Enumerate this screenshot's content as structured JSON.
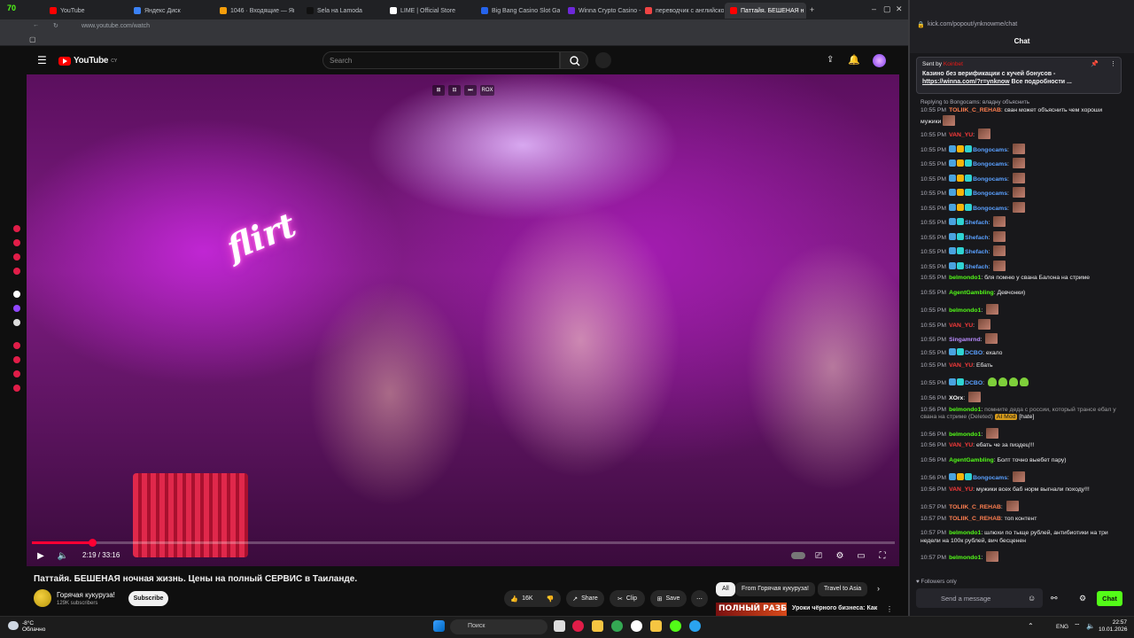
{
  "browser": {
    "tabs": [
      {
        "label": "YouTube",
        "color": "#ff0000"
      },
      {
        "label": "Яндекс Диск",
        "color": "#3b82f6"
      },
      {
        "label": "1046 · Входящие — Янд",
        "color": "#f59e0b"
      },
      {
        "label": "Sela на Lamoda",
        "color": "#111111"
      },
      {
        "label": "LIME | Official Store",
        "color": "#ffffff"
      },
      {
        "label": "Big Bang Casino Slot Gam",
        "color": "#2563eb"
      },
      {
        "label": "Winna Crypto Casino - Be",
        "color": "#6d28d9"
      },
      {
        "label": "переводчик с английско",
        "color": "#ef4444"
      },
      {
        "label": "Паттайя. БЕШЕНАЯ н",
        "color": "#ff0000"
      }
    ],
    "tab_counter": "70",
    "url": "www.youtube.com/watch",
    "chat_url": "kick.com/popout/ynknowme/chat"
  },
  "youtube": {
    "logo": "YouTube",
    "logo_region": "CY",
    "search_placeholder": "Search",
    "video": {
      "sign_text": "flirt",
      "overlay_labels": [
        "⊞",
        "⊟",
        "⏭",
        "ROX"
      ],
      "time_current": "2:19",
      "time_total": "33:16",
      "progress_fraction": 0.07
    },
    "title": "Паттайя. БЕШЕНАЯ ночная жизнь. Цены на полный СЕРВИС в Таиланде.",
    "channel": "Горячая кукуруза!",
    "subscribers": "129K subscribers",
    "subscribe_label": "Subscribe",
    "like_count": "16K",
    "share_label": "Share",
    "clip_label": "Clip",
    "save_label": "Save",
    "chips": [
      "All",
      "From Горячая кукуруза!",
      "Travel to Asia"
    ],
    "rec_thumb_text": "ПОЛНЫЙ РАЗБОР",
    "rec_title": "Уроки чёрного бизнеса: Как"
  },
  "chat": {
    "title": "Chat",
    "pinned": {
      "sent_by_label": "Sent by",
      "sent_by_user": "Koinbet",
      "text_line1": "Казино без верификации с кучей бонусов -",
      "link": "https://winna.com/?r=ynknow",
      "text_line2": "Все подробности ..."
    },
    "reply_context": "Replying to Bongocams: владну объяснить",
    "messages": [
      {
        "time": "10:55 PM",
        "user": "TOLIIK_C_REHAB",
        "color": "#ff7f50",
        "text": "сван может объяснить чем хороши мужики",
        "wrap": true,
        "emote": true,
        "badges": []
      },
      {
        "time": "10:55 PM",
        "user": "VAN_YU",
        "color": "#ff3b3b",
        "text": "",
        "emote": true,
        "badges": []
      },
      {
        "time": "10:55 PM",
        "user": "Bongocams",
        "color": "#5aa0ff",
        "text": "",
        "emote": true,
        "badges": [
          "#4aa3df",
          "#f5b50b",
          "#2fd3d3"
        ]
      },
      {
        "time": "10:55 PM",
        "user": "Bongocams",
        "color": "#5aa0ff",
        "text": "",
        "emote": true,
        "badges": [
          "#4aa3df",
          "#f5b50b",
          "#2fd3d3"
        ]
      },
      {
        "time": "10:55 PM",
        "user": "Bongocams",
        "color": "#5aa0ff",
        "text": "",
        "emote": true,
        "badges": [
          "#4aa3df",
          "#f5b50b",
          "#2fd3d3"
        ]
      },
      {
        "time": "10:55 PM",
        "user": "Bongocams",
        "color": "#5aa0ff",
        "text": "",
        "emote": true,
        "badges": [
          "#4aa3df",
          "#f5b50b",
          "#2fd3d3"
        ]
      },
      {
        "time": "10:55 PM",
        "user": "Bongocams",
        "color": "#5aa0ff",
        "text": "",
        "emote": true,
        "badges": [
          "#4aa3df",
          "#f5b50b",
          "#2fd3d3"
        ]
      },
      {
        "time": "10:55 PM",
        "user": "Shefach",
        "color": "#5aa0ff",
        "text": "",
        "emote": true,
        "badges": [
          "#4aa3df",
          "#2fd3d3"
        ]
      },
      {
        "time": "10:55 PM",
        "user": "Shefach",
        "color": "#5aa0ff",
        "text": "",
        "emote": true,
        "badges": [
          "#4aa3df",
          "#2fd3d3"
        ]
      },
      {
        "time": "10:55 PM",
        "user": "Shefach",
        "color": "#5aa0ff",
        "text": "",
        "emote": true,
        "badges": [
          "#4aa3df",
          "#2fd3d3"
        ]
      },
      {
        "time": "10:55 PM",
        "user": "Shefach",
        "color": "#5aa0ff",
        "text": "",
        "emote": true,
        "badges": [
          "#4aa3df",
          "#2fd3d3"
        ]
      },
      {
        "time": "10:55 PM",
        "user": "belmondo1",
        "color": "#53fc18",
        "text": "бля помню у свана Балона на стриме",
        "emote": false,
        "badges": []
      },
      {
        "time": "10:55 PM",
        "user": "AgentGambling",
        "color": "#53fc18",
        "text": "Девчонки)",
        "emote": false,
        "badges": []
      },
      {
        "time": "10:55 PM",
        "user": "belmondo1",
        "color": "#53fc18",
        "text": "",
        "emote": true,
        "badges": []
      },
      {
        "time": "10:55 PM",
        "user": "VAN_YU",
        "color": "#ff3b3b",
        "text": "",
        "emote": true,
        "badges": []
      },
      {
        "time": "10:55 PM",
        "user": "Singamrnd",
        "color": "#b98cff",
        "text": "",
        "emote": true,
        "badges": []
      },
      {
        "time": "10:55 PM",
        "user": "DCBO",
        "color": "#5aa0ff",
        "text": "ехало",
        "emote": false,
        "badges": [
          "#4aa3df",
          "#2fd3d3"
        ]
      },
      {
        "time": "10:55 PM",
        "user": "VAN_YU",
        "color": "#ff3b3b",
        "text": "Ебать",
        "emote": false,
        "badges": []
      },
      {
        "time": "10:55 PM",
        "user": "DCBO",
        "color": "#5aa0ff",
        "text": "",
        "emote": false,
        "greens": 4,
        "badges": [
          "#4aa3df",
          "#2fd3d3"
        ]
      },
      {
        "time": "10:56 PM",
        "user": "XOrx",
        "color": "#ffffff",
        "text": "",
        "emote": true,
        "badges": []
      },
      {
        "time": "10:56 PM",
        "user": "belmondo1",
        "color": "#53fc18",
        "text": "помните деда с россии, который трансе ебал у свана на стриме (Deleted)",
        "wrap": true,
        "emote": false,
        "badges": [],
        "mod": "AI Mod",
        "tag": "[hate]"
      },
      {
        "time": "10:56 PM",
        "user": "belmondo1",
        "color": "#53fc18",
        "text": "",
        "emote": true,
        "badges": []
      },
      {
        "time": "10:56 PM",
        "user": "VAN_YU",
        "color": "#ff3b3b",
        "text": "ебать че за пиздец!!!",
        "emote": false,
        "badges": []
      },
      {
        "time": "10:56 PM",
        "user": "AgentGambling",
        "color": "#53fc18",
        "text": "Болт точно выебет пару)",
        "emote": false,
        "badges": []
      },
      {
        "time": "10:56 PM",
        "user": "Bongocams",
        "color": "#5aa0ff",
        "text": "",
        "emote": true,
        "badges": [
          "#4aa3df",
          "#f5b50b",
          "#2fd3d3"
        ]
      },
      {
        "time": "10:56 PM",
        "user": "VAN_YU",
        "color": "#ff3b3b",
        "text": "мужики всех баб норм выгнали походу!!!",
        "emote": false,
        "badges": []
      },
      {
        "time": "10:57 PM",
        "user": "TOLIIK_C_REHAB",
        "color": "#ff7f50",
        "text": "",
        "emote": true,
        "badges": []
      },
      {
        "time": "10:57 PM",
        "user": "TOLIIK_C_REHAB",
        "color": "#ff7f50",
        "text": "топ контент",
        "emote": false,
        "badges": []
      },
      {
        "time": "10:57 PM",
        "user": "belmondo1",
        "color": "#53fc18",
        "text": "шлюхи по тыще рублей, антибиотики на три недели на 100к рублей, вич бесценен",
        "wrap": true,
        "emote": false,
        "badges": []
      },
      {
        "time": "10:57 PM",
        "user": "belmondo1",
        "color": "#53fc18",
        "text": "",
        "emote": true,
        "badges": []
      }
    ],
    "followers_only": "Followers only",
    "input_placeholder": "Send a message",
    "send_label": "Chat"
  },
  "taskbar": {
    "weather_temp": "-8°C",
    "weather_desc": "Облачно",
    "search_label": "Поиск",
    "lang": "ENG",
    "time": "22:57",
    "date": "10.01.2026"
  }
}
